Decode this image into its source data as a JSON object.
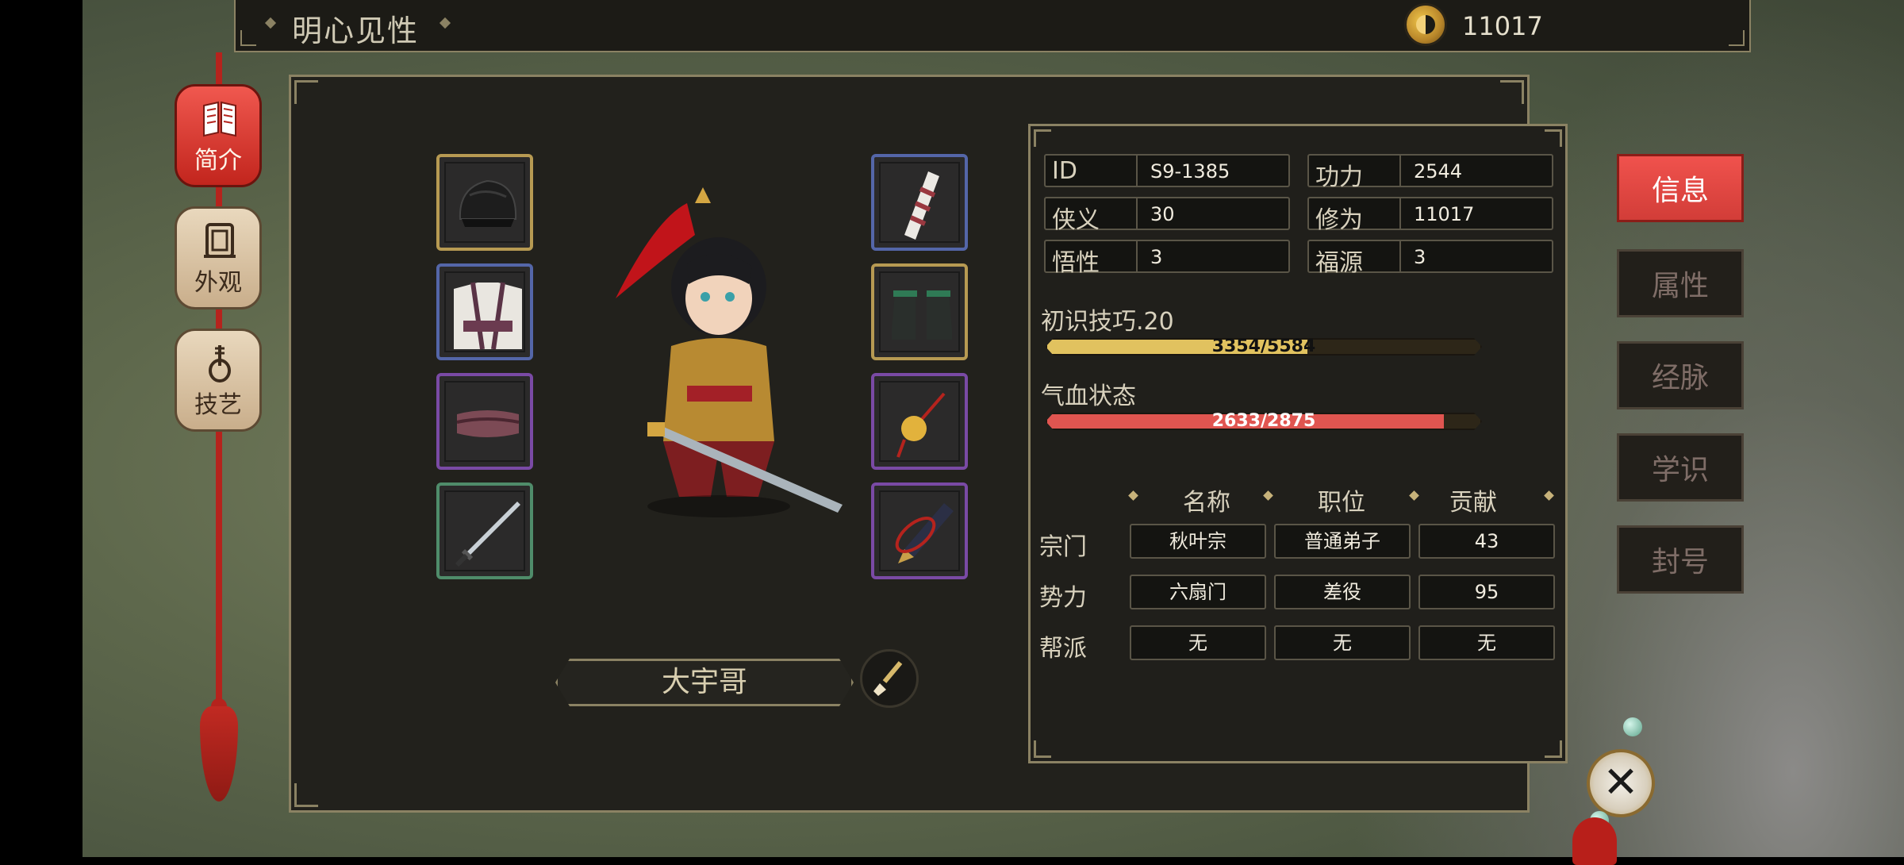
{
  "header": {
    "title": "明心见性",
    "currency_icon": "taiji-coin-icon",
    "currency_value": "11017"
  },
  "sidebar": {
    "items": [
      {
        "label": "简介",
        "icon": "book-icon",
        "active": true
      },
      {
        "label": "外观",
        "icon": "mirror-icon",
        "active": false
      },
      {
        "label": "技艺",
        "icon": "pipa-icon",
        "active": false
      }
    ]
  },
  "equipment": {
    "left": [
      {
        "slot": "hat-icon",
        "rarity": "gold"
      },
      {
        "slot": "robe-icon",
        "rarity": "blue"
      },
      {
        "slot": "belt-icon",
        "rarity": "purple"
      },
      {
        "slot": "sword-icon",
        "rarity": "green"
      }
    ],
    "right": [
      {
        "slot": "bracer-icon",
        "rarity": "blue"
      },
      {
        "slot": "boots-icon",
        "rarity": "gold"
      },
      {
        "slot": "pendant-icon",
        "rarity": "purple"
      },
      {
        "slot": "scroll-icon",
        "rarity": "purple"
      }
    ]
  },
  "character": {
    "name": "大宇哥",
    "rename_icon": "brush-icon"
  },
  "stats": {
    "id_label": "ID",
    "id_value": "S9-1385",
    "power_label": "功力",
    "power_value": "2544",
    "chivalry_label": "侠义",
    "chivalry_value": "30",
    "cultivation_label": "修为",
    "cultivation_value": "11017",
    "insight_label": "悟性",
    "insight_value": "3",
    "fortune_label": "福源",
    "fortune_value": "3"
  },
  "skill_bar": {
    "label": "初识技巧.20",
    "current": 3354,
    "max": 5584,
    "text": "3354/5584",
    "color": "#e1c25f"
  },
  "health_bar": {
    "label": "气血状态",
    "current": 2633,
    "max": 2875,
    "text": "2633/2875",
    "color": "#e05550"
  },
  "affiliations": {
    "columns": [
      "名称",
      "职位",
      "贡献"
    ],
    "rows": [
      {
        "label": "宗门",
        "values": [
          "秋叶宗",
          "普通弟子",
          "43"
        ]
      },
      {
        "label": "势力",
        "values": [
          "六扇门",
          "差役",
          "95"
        ]
      },
      {
        "label": "帮派",
        "values": [
          "无",
          "无",
          "无"
        ]
      }
    ]
  },
  "right_tabs": [
    {
      "label": "信息",
      "active": true
    },
    {
      "label": "属性",
      "active": false
    },
    {
      "label": "经脉",
      "active": false
    },
    {
      "label": "学识",
      "active": false
    },
    {
      "label": "封号",
      "active": false
    }
  ],
  "close_icon": "close-icon"
}
